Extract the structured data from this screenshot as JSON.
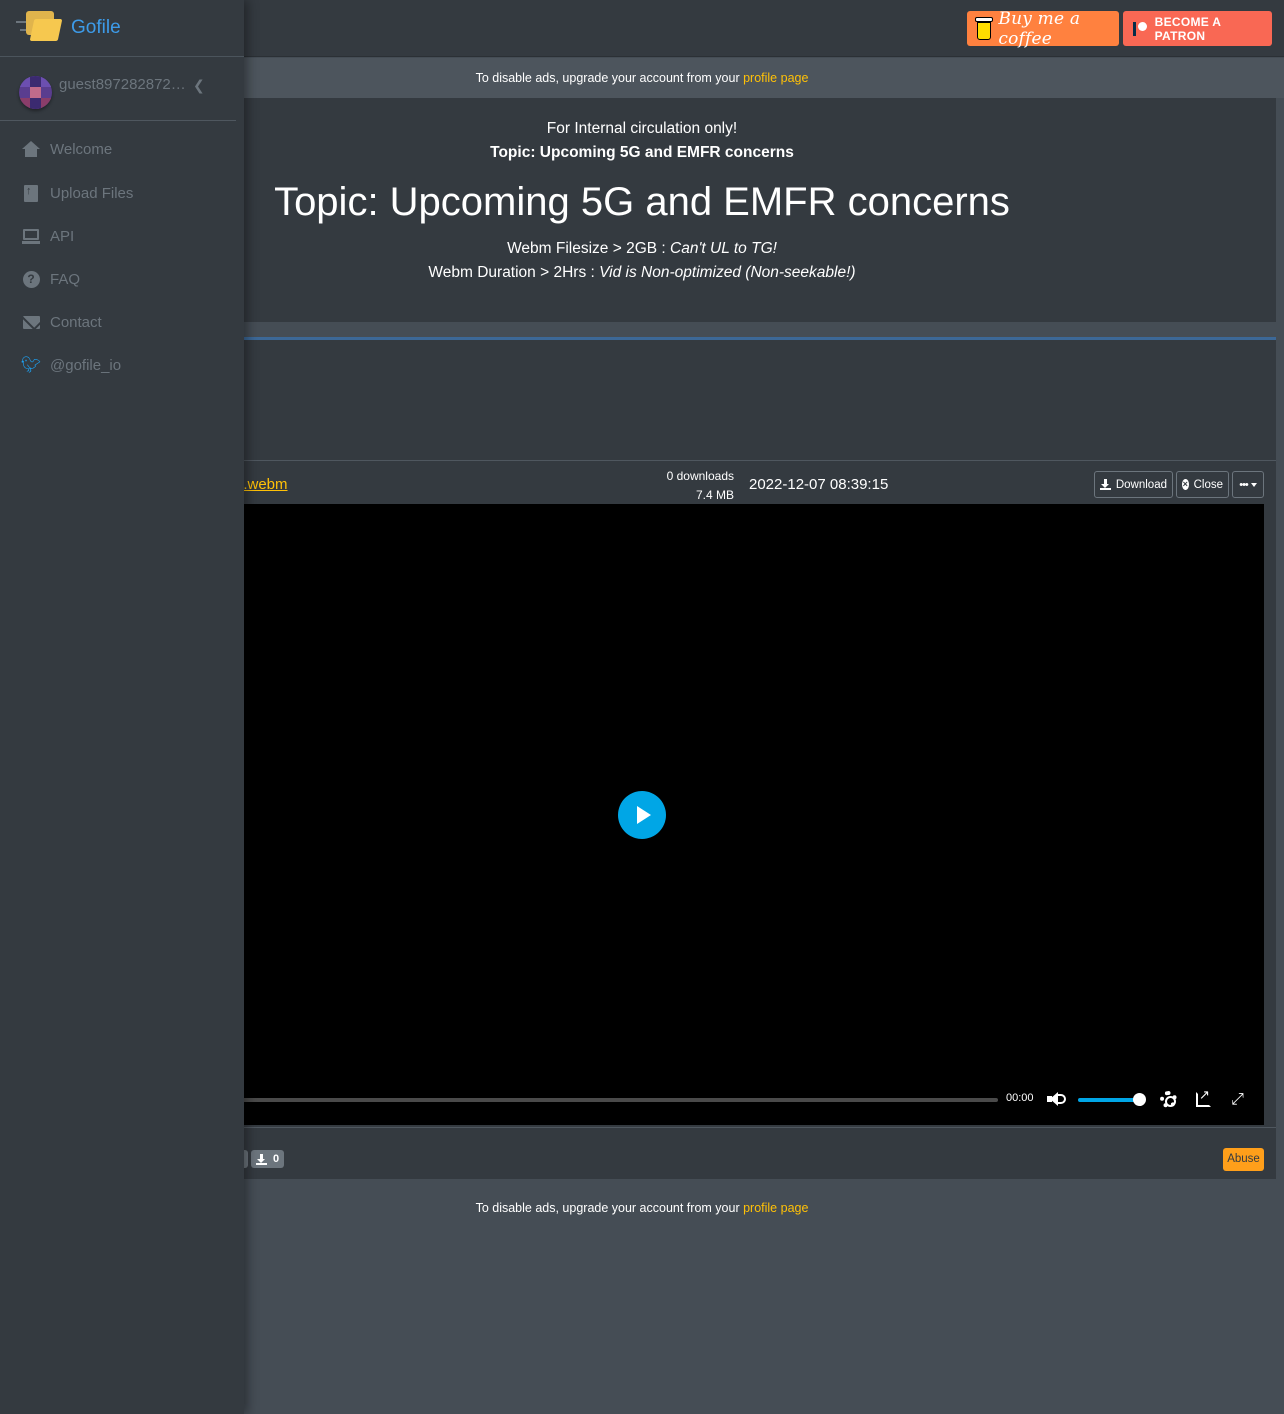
{
  "topbar": {
    "bmc_label": "Buy me a coffee",
    "patron_label": "BECOME A PATRON"
  },
  "ads": {
    "text": "To disable ads, upgrade your account from your",
    "link": "profile page"
  },
  "description": {
    "line1": "For Internal circulation only!",
    "line2": "Topic: Upcoming 5G and EMFR concerns",
    "heading": "Topic: Upcoming 5G and EMFR concerns",
    "line3_prefix": "Webm Filesize > 2GB : ",
    "line3_italic": "Can't UL to TG!",
    "line4_prefix": "Webm Duration > 2Hrs : ",
    "line4_italic": "Vid is Non-optimized (Non-seekable!)"
  },
  "file": {
    "name": "l.webm",
    "downloads": "0 downloads",
    "size": "7.4 MB",
    "date": "2022-12-07 08:39:15",
    "download_label": "Download",
    "close_label": "Close",
    "more_label": "•••"
  },
  "player": {
    "time": "00:00",
    "volume": 1.0,
    "progress": 0.0
  },
  "footer": {
    "download_count": "0",
    "abuse_label": "Abuse"
  },
  "sidebar": {
    "brand": "Gofile",
    "user": "guest8972828727...",
    "items": [
      {
        "label": "Welcome",
        "icon": "home-icon"
      },
      {
        "label": "Upload Files",
        "icon": "file-upload-icon"
      },
      {
        "label": "API",
        "icon": "laptop-code-icon"
      },
      {
        "label": "FAQ",
        "icon": "question-circle-icon"
      },
      {
        "label": "Contact",
        "icon": "envelope-icon"
      },
      {
        "label": "@gofile_io",
        "icon": "twitter-icon"
      }
    ]
  },
  "colors": {
    "accent": "#ffc107",
    "brand": "#3d9be9",
    "player": "#00a6e6",
    "abuse": "#ff9f1a"
  }
}
